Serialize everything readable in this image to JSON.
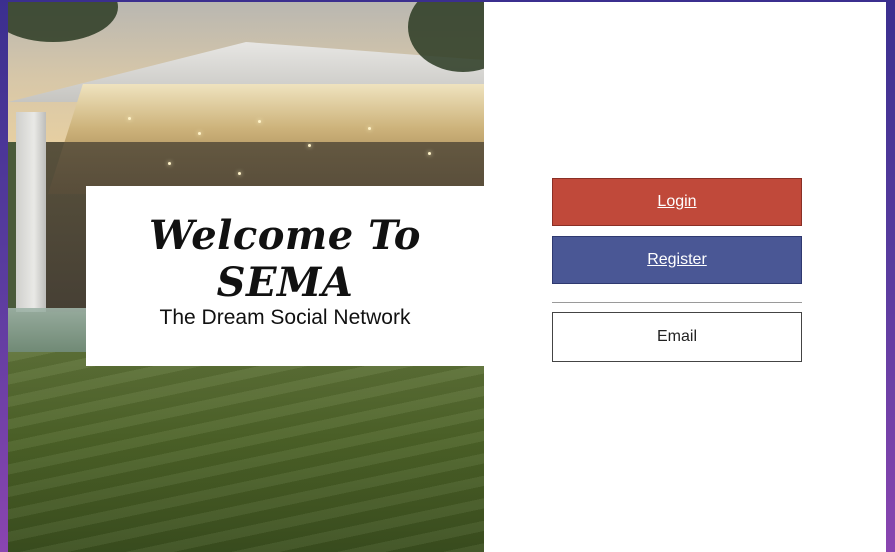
{
  "welcome": {
    "title": "Welcome To SEMA",
    "subtitle": "The Dream Social Network"
  },
  "auth": {
    "login_label": "Login",
    "register_label": "Register",
    "email_label": "Email"
  },
  "colors": {
    "login": "#c0493a",
    "register": "#4a5795",
    "frame_gradient_start": "#3b2f8f",
    "frame_gradient_end": "#8a45b0"
  }
}
